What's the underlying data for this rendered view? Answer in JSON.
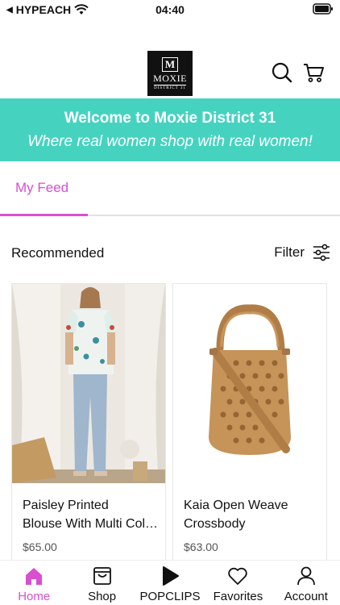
{
  "status": {
    "carrier": "HYPEACH",
    "time": "04:40"
  },
  "brand": {
    "logo_mark": "M",
    "logo_name": "MOXIE",
    "logo_sub": "DISTRICT 31"
  },
  "banner": {
    "title": "Welcome to Moxie District 31",
    "subtitle": "Where real women shop with real women!"
  },
  "tabs": [
    {
      "label": "My Feed",
      "active": true
    }
  ],
  "feed": {
    "section_title": "Recommended",
    "filter_label": "Filter",
    "products": [
      {
        "name_line1": "Paisley Printed",
        "name_line2": "Blouse With Multi Color Embroidery",
        "price": "$65.00"
      },
      {
        "name_line1": "Kaia Open Weave",
        "name_line2": "Crossbody",
        "price": "$63.00"
      }
    ]
  },
  "nav": [
    {
      "label": "Home",
      "icon": "home-icon",
      "active": true
    },
    {
      "label": "Shop",
      "icon": "shop-icon",
      "active": false
    },
    {
      "label": "POPCLIPS",
      "icon": "play-icon",
      "active": false
    },
    {
      "label": "Favorites",
      "icon": "heart-icon",
      "active": false
    },
    {
      "label": "Account",
      "icon": "person-icon",
      "active": false
    }
  ],
  "colors": {
    "accent": "#d94fcf",
    "banner": "#45d3c0"
  }
}
